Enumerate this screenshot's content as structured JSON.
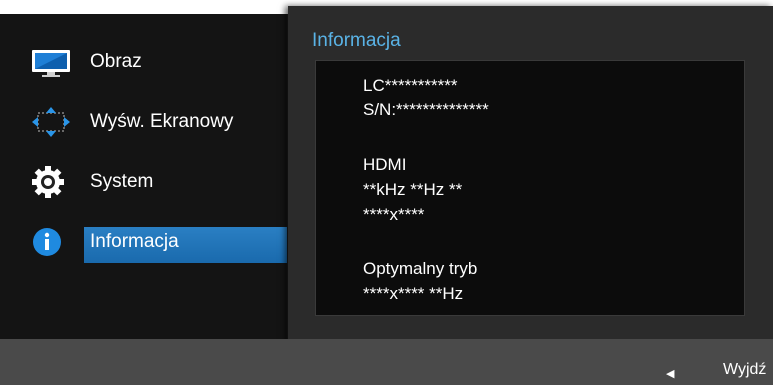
{
  "menu": {
    "items": [
      {
        "label": "Obraz",
        "icon": "monitor-icon"
      },
      {
        "label": "Wyśw. Ekranowy",
        "icon": "screen-arrows-icon"
      },
      {
        "label": "System",
        "icon": "gear-icon"
      },
      {
        "label": "Informacja",
        "icon": "info-icon"
      }
    ],
    "selected_index": 3,
    "accent": "#2a7fc3"
  },
  "info_panel": {
    "title": "Informacja",
    "model": "LC***********",
    "serial": "S/N:**************",
    "input": "HDMI",
    "frequency": "**kHz **Hz **",
    "resolution": "****x****",
    "optimal_label": "Optymalny tryb",
    "optimal_value": "****x**** **Hz"
  },
  "footer": {
    "exit_icon": "left-arrow-icon",
    "exit_label": "Wyjdź"
  }
}
